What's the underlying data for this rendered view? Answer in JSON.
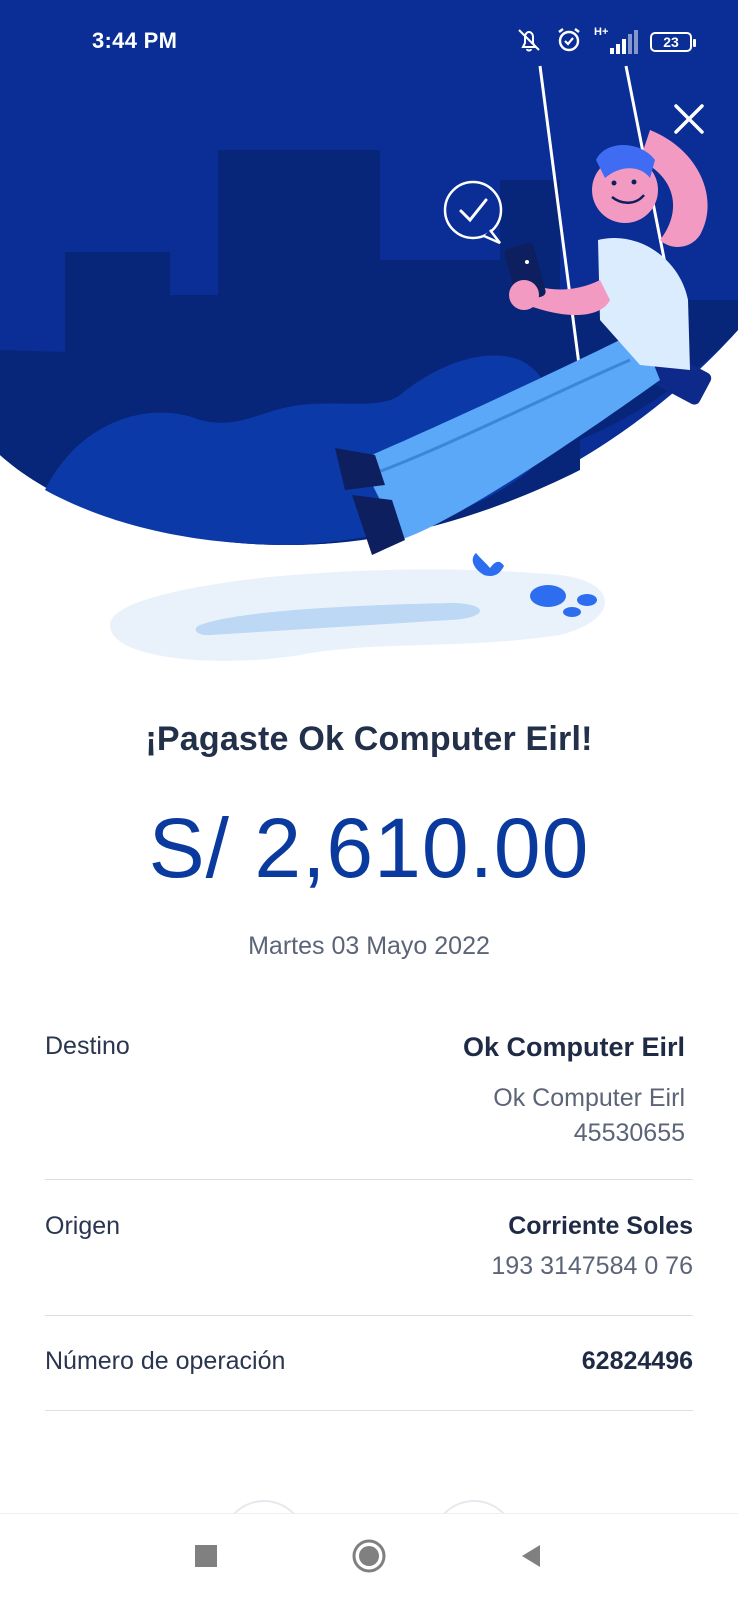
{
  "status_bar": {
    "time": "3:44 PM",
    "battery": "23",
    "network": "H+",
    "icons": [
      "mute-icon",
      "alarm-icon",
      "signal-icon",
      "battery-icon"
    ]
  },
  "hero": {
    "illustration": "person-on-swing-illustration",
    "close_icon": "close-icon"
  },
  "receipt": {
    "title": "¡Pagaste Ok Computer Eirl!",
    "amount": "S/ 2,610.00",
    "date": "Martes 03 Mayo 2022"
  },
  "details": {
    "destino": {
      "label": "Destino",
      "name": "Ok Computer Eirl",
      "subname": "Ok Computer Eirl",
      "number": "45530655"
    },
    "origen": {
      "label": "Origen",
      "account_type": "Corriente Soles",
      "account_number": "193 3147584 0 76"
    },
    "operacion": {
      "label": "Número de operación",
      "value": "62824496"
    }
  },
  "nav": {
    "icons": [
      "recents-icon",
      "home-icon",
      "back-icon"
    ]
  },
  "colors": {
    "primary": "#0a3a9e",
    "hero_bg": "#0a2d96",
    "text_dark": "#1f2a44",
    "text_muted": "#5c6478"
  }
}
